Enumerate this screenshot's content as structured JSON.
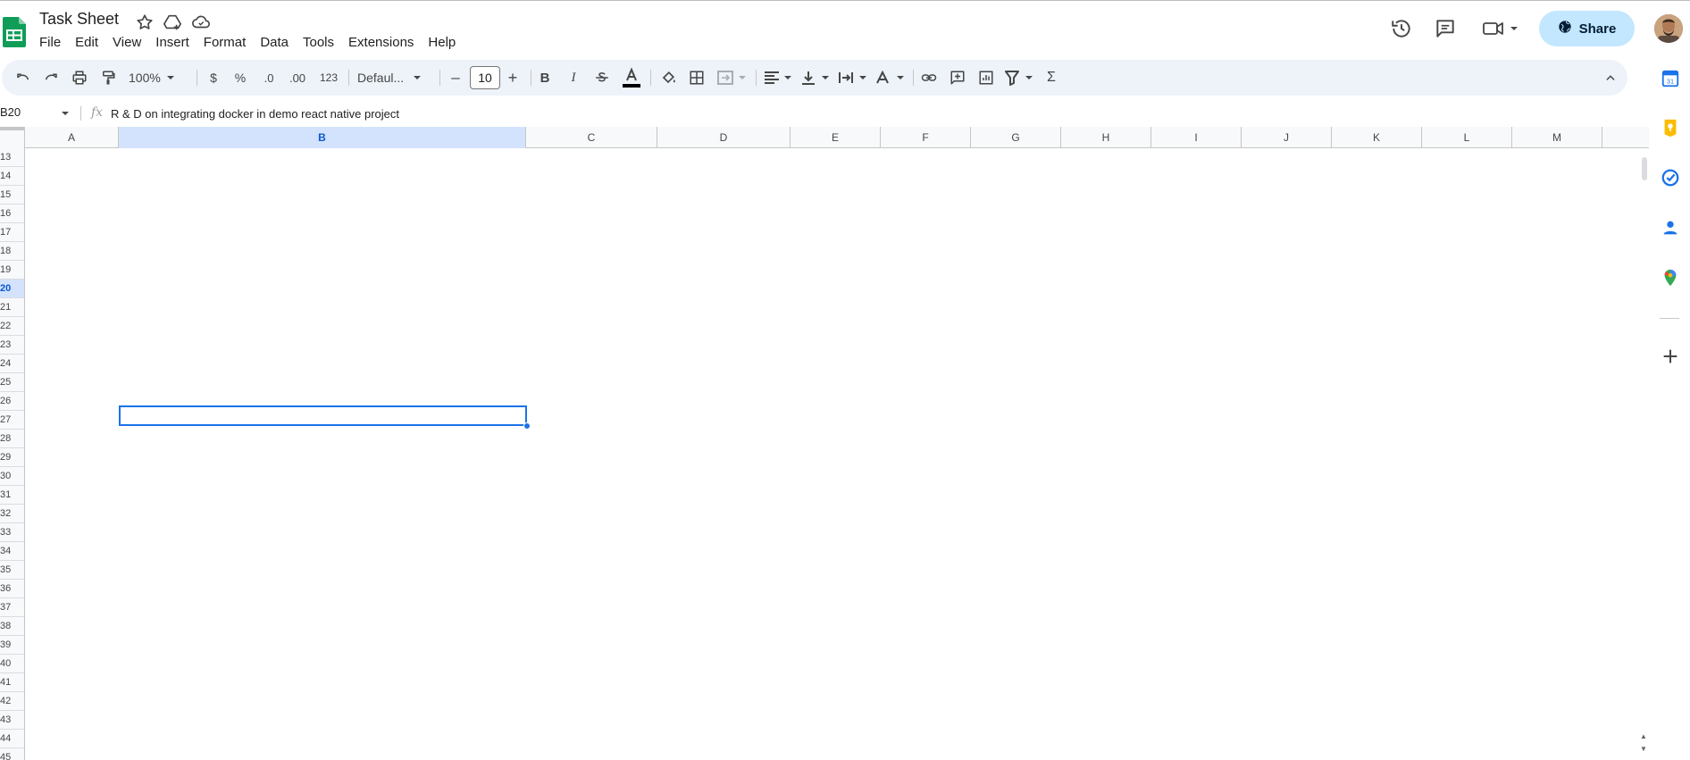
{
  "app": {
    "title": "Task Sheet",
    "menu": [
      "File",
      "Edit",
      "View",
      "Insert",
      "Format",
      "Data",
      "Tools",
      "Extensions",
      "Help"
    ],
    "share_label": "Share"
  },
  "toolbar": {
    "zoom": "100%",
    "currency": "$",
    "percent": "%",
    "decrease_decimal": ".0",
    "increase_decimal": ".00",
    "number_format": "123",
    "font": "Defaul...",
    "font_size": "10",
    "font_size_minus": "–",
    "font_size_plus": "+",
    "bold": "B",
    "italic": "I",
    "sum": "Σ"
  },
  "formula_bar": {
    "cell_ref": "B20",
    "fx": "fx",
    "value": "R & D on integrating docker in demo react native project"
  },
  "grid": {
    "columns": [
      "A",
      "B",
      "C",
      "D",
      "E",
      "F",
      "G",
      "H",
      "I",
      "J",
      "K",
      "L",
      "M"
    ],
    "selected_column": "B",
    "rows": [
      "13",
      "14",
      "15",
      "16",
      "17",
      "18",
      "19",
      "20",
      "21",
      "22",
      "23",
      "24",
      "25",
      "26",
      "27",
      "28",
      "29",
      "30",
      "31",
      "32",
      "33",
      "34",
      "35",
      "36",
      "37",
      "38",
      "39",
      "40",
      "41",
      "42",
      "43",
      "44",
      "45"
    ],
    "selected_row": "20",
    "selected_cell": "B20"
  },
  "colors": {
    "accent": "#1a73e8",
    "share_bg": "#c2e7ff",
    "toolbar_bg": "#eef2f9",
    "sheets_green": "#0f9d58"
  },
  "icons": {
    "star": "star-icon",
    "move": "move-to-drive-icon",
    "cloud": "cloud-status-icon",
    "history": "history-icon",
    "comments": "comments-icon",
    "meet": "video-call-icon",
    "globe": "globe-icon"
  }
}
